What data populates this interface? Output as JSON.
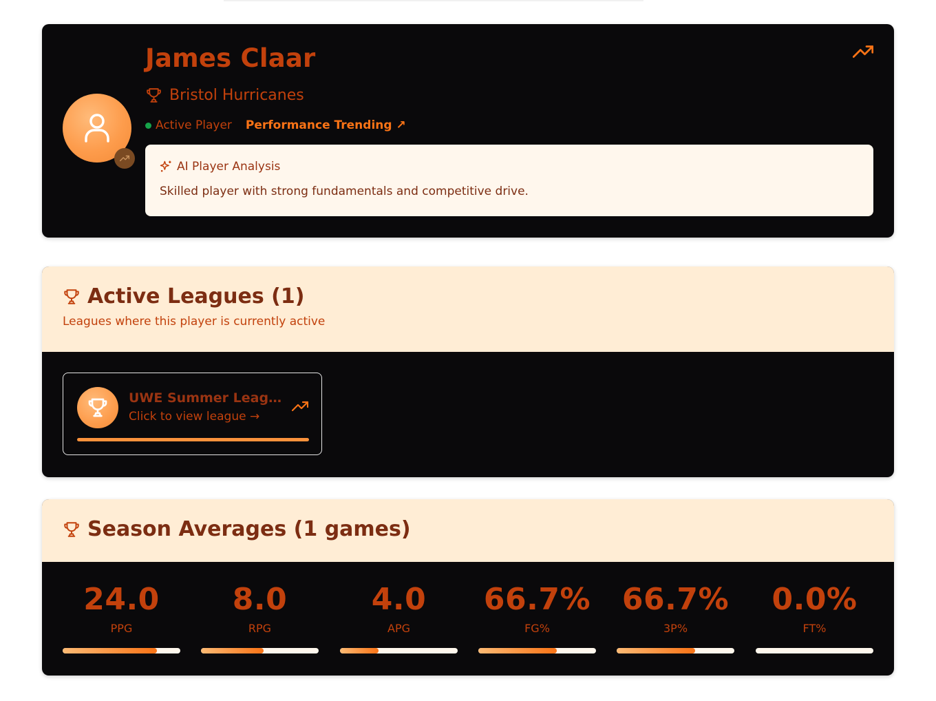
{
  "player": {
    "name": "James Claar",
    "team": "Bristol Hurricanes",
    "status": "Active Player",
    "trend": "Performance Trending ↗",
    "analysis_title": "AI Player Analysis",
    "analysis_text": "Skilled player with strong fundamentals and competitive drive."
  },
  "leagues": {
    "title": "Active Leagues (1)",
    "subtitle": "Leagues where this player is currently active",
    "items": [
      {
        "name": "UWE Summer League",
        "link": "Click to view league →"
      }
    ]
  },
  "averages": {
    "title": "Season Averages (1 games)",
    "stats": [
      {
        "value": "24.0",
        "label": "PPG",
        "fill": 0.8
      },
      {
        "value": "8.0",
        "label": "RPG",
        "fill": 0.53
      },
      {
        "value": "4.0",
        "label": "APG",
        "fill": 0.33
      },
      {
        "value": "66.7%",
        "label": "FG%",
        "fill": 0.667
      },
      {
        "value": "66.7%",
        "label": "3P%",
        "fill": 0.667
      },
      {
        "value": "0.0%",
        "label": "FT%",
        "fill": 0.0
      }
    ]
  },
  "colors": {
    "accent": "#c2410c",
    "orange": "#f97316",
    "cream": "#fff7ed",
    "header": "#ffedd5",
    "card": "#0a090b",
    "active": "#16a34a"
  },
  "icons": {
    "avatar": "user-icon",
    "team": "trophy-icon",
    "analysis": "sparkles-icon",
    "trend": "trending-up-icon"
  }
}
